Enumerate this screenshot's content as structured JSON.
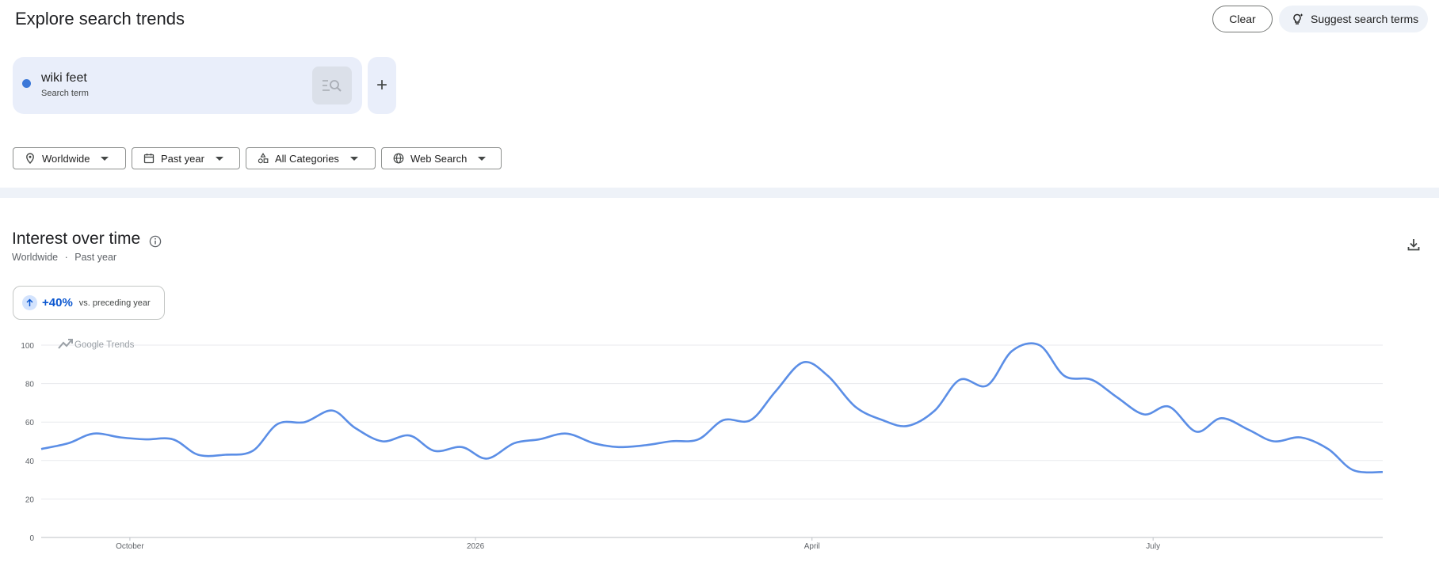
{
  "header": {
    "title": "Explore search trends",
    "clear_label": "Clear",
    "suggest_label": "Suggest search terms"
  },
  "term": {
    "name": "wiki feet",
    "type": "Search term",
    "color": "#3c78d8"
  },
  "filters": {
    "location": "Worldwide",
    "time": "Past year",
    "category": "All Categories",
    "property": "Web Search"
  },
  "section": {
    "title": "Interest over time",
    "location": "Worldwide",
    "separator": "·",
    "time": "Past year"
  },
  "change": {
    "value": "+40%",
    "label": "vs. preceding year"
  },
  "chart_data": {
    "type": "line",
    "watermark": "Google Trends",
    "ylim": [
      0,
      100
    ],
    "yticks": [
      0,
      20,
      40,
      60,
      80,
      100
    ],
    "x_ticks": [
      {
        "label": "October",
        "x": 3.9
      },
      {
        "label": "2026",
        "x": 19.1
      },
      {
        "label": "April",
        "x": 33.9
      },
      {
        "label": "July",
        "x": 48.9
      }
    ],
    "grid": true,
    "series": [
      {
        "color": "#5b8ee6",
        "points": [
          [
            0,
            46
          ],
          [
            1.2,
            49
          ],
          [
            2.3,
            54
          ],
          [
            3.5,
            52
          ],
          [
            4.6,
            51
          ],
          [
            5.8,
            51
          ],
          [
            6.9,
            43
          ],
          [
            8.1,
            43
          ],
          [
            9.3,
            45
          ],
          [
            10.4,
            59
          ],
          [
            11.6,
            60
          ],
          [
            12.8,
            66
          ],
          [
            13.8,
            57
          ],
          [
            15.0,
            50
          ],
          [
            16.2,
            53
          ],
          [
            17.3,
            45
          ],
          [
            18.5,
            47
          ],
          [
            19.6,
            41
          ],
          [
            20.8,
            49
          ],
          [
            21.9,
            51
          ],
          [
            23.1,
            54
          ],
          [
            24.3,
            49
          ],
          [
            25.4,
            47
          ],
          [
            26.6,
            48
          ],
          [
            27.7,
            50
          ],
          [
            28.9,
            51
          ],
          [
            30.0,
            61
          ],
          [
            31.2,
            61
          ],
          [
            32.3,
            76
          ],
          [
            33.5,
            91
          ],
          [
            34.6,
            84
          ],
          [
            35.8,
            68
          ],
          [
            37.0,
            61
          ],
          [
            38.1,
            58
          ],
          [
            39.3,
            66
          ],
          [
            40.4,
            82
          ],
          [
            41.6,
            79
          ],
          [
            42.7,
            97
          ],
          [
            43.9,
            100
          ],
          [
            45.0,
            84
          ],
          [
            46.2,
            82
          ],
          [
            47.3,
            73
          ],
          [
            48.5,
            64
          ],
          [
            49.6,
            68
          ],
          [
            50.8,
            55
          ],
          [
            51.9,
            62
          ],
          [
            53.1,
            56
          ],
          [
            54.2,
            50
          ],
          [
            55.4,
            52
          ],
          [
            56.6,
            46
          ],
          [
            57.7,
            35
          ],
          [
            59.0,
            34
          ]
        ]
      }
    ]
  }
}
